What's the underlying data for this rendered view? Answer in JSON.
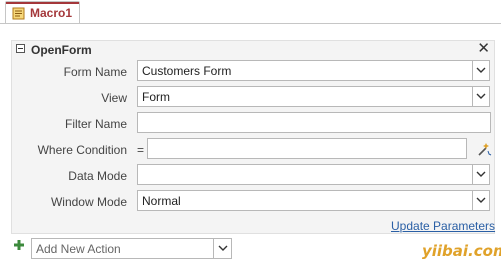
{
  "tab": {
    "label": "Macro1",
    "icon": "macro-icon"
  },
  "action": {
    "name": "OpenForm",
    "fields": [
      {
        "label": "Form Name",
        "value": "Customers Form",
        "has_dropdown": true
      },
      {
        "label": "View",
        "value": "Form",
        "has_dropdown": true
      },
      {
        "label": "Filter Name",
        "value": "",
        "has_dropdown": false
      },
      {
        "label": "Where Condition",
        "prefix": "=",
        "value": "",
        "has_builder": true
      },
      {
        "label": "Data Mode",
        "value": "",
        "has_dropdown": true
      },
      {
        "label": "Window Mode",
        "value": "Normal",
        "has_dropdown": true
      }
    ],
    "update_parameters_label": "Update Parameters"
  },
  "add_action": {
    "placeholder": "Add New Action"
  },
  "watermark": "yiibai.com",
  "colors": {
    "tab_accent": "#a4373a",
    "link": "#2a5fa5",
    "plus_green": "#3c8a3c"
  }
}
